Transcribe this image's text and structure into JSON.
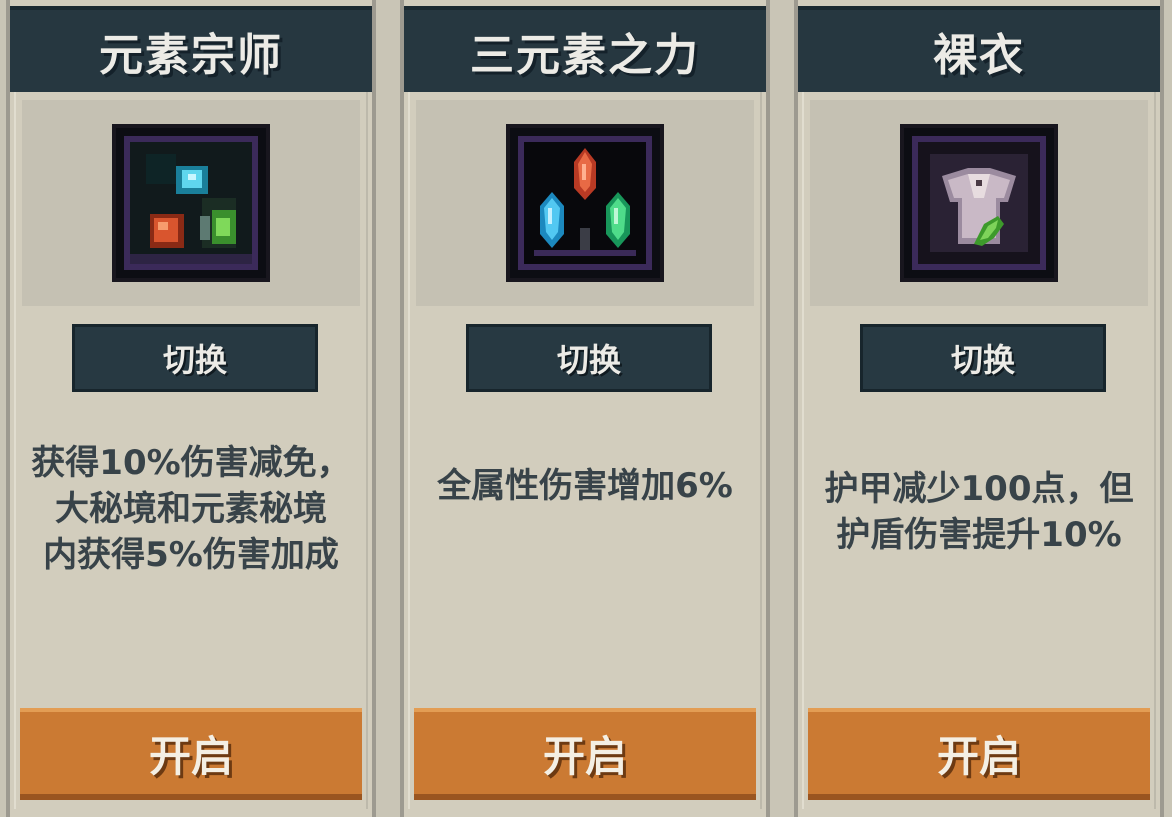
{
  "cards": [
    {
      "title": "元素宗师",
      "icon": "element-master-icon",
      "switch_label": "切换",
      "description": [
        "获得10%伤害减免，",
        "大秘境和元素秘境",
        "内获得5%伤害加成"
      ],
      "enable_label": "开启"
    },
    {
      "title": "三元素之力",
      "icon": "three-element-crystals-icon",
      "switch_label": "切换",
      "description": [
        "",
        "全属性伤害增加6%",
        ""
      ],
      "enable_label": "开启"
    },
    {
      "title": "裸衣",
      "icon": "bare-robe-icon",
      "switch_label": "切换",
      "description": [
        "护甲减少100点，但",
        "护盾伤害提升10%",
        ""
      ],
      "enable_label": "开启"
    }
  ],
  "colors": {
    "header": "#263740",
    "card": "#d2cdbd",
    "button_dark": "#273942",
    "button_orange": "#cb7a33",
    "text_dark": "#384349"
  }
}
